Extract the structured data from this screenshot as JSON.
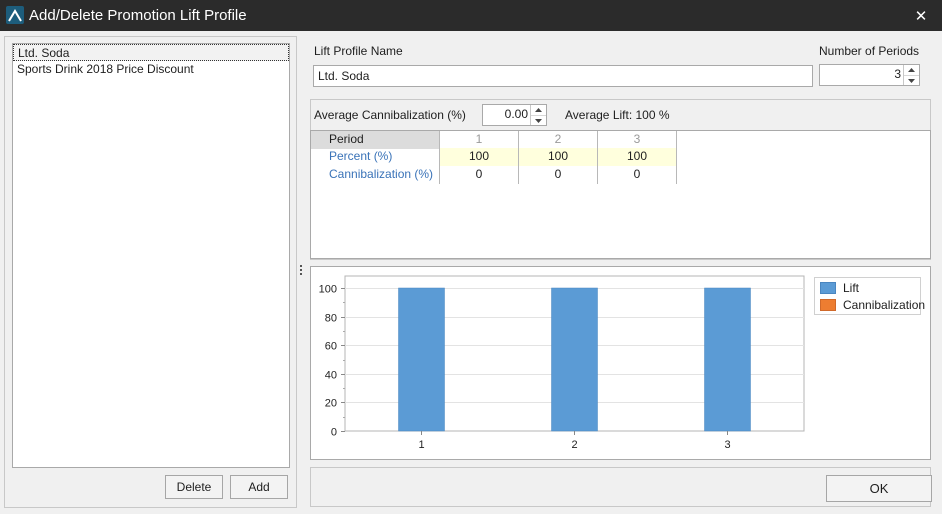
{
  "window": {
    "title": "Add/Delete Promotion Lift Profile",
    "close_glyph": "✕"
  },
  "profiles": {
    "items": [
      "Ltd. Soda",
      "Sports Drink 2018 Price Discount"
    ],
    "selected_index": 0,
    "delete_label": "Delete",
    "add_label": "Add"
  },
  "form": {
    "name_label": "Lift Profile Name",
    "name_value": "Ltd. Soda",
    "periods_label": "Number of Periods",
    "periods_value": "3",
    "cannibalization_label": "Average Cannibalization (%)",
    "cannibalization_value": "0.00",
    "average_lift": "Average Lift: 100 %"
  },
  "grid": {
    "corner_header": "Period",
    "columns": [
      "1",
      "2",
      "3"
    ],
    "rows": [
      {
        "label": "Percent (%)",
        "values": [
          "100",
          "100",
          "100"
        ]
      },
      {
        "label": "Cannibalization (%)",
        "values": [
          "0",
          "0",
          "0"
        ]
      }
    ]
  },
  "chart_data": {
    "type": "bar",
    "categories": [
      "1",
      "2",
      "3"
    ],
    "series": [
      {
        "name": "Lift",
        "values": [
          100,
          100,
          100
        ],
        "color": "#5b9bd5"
      },
      {
        "name": "Cannibalization",
        "values": [
          0,
          0,
          0
        ],
        "color": "#ed7d31"
      }
    ],
    "ylim": [
      0,
      100
    ],
    "yticks": [
      0,
      20,
      40,
      60,
      80,
      100
    ],
    "grid": true,
    "legend_position": "top-right"
  },
  "footer": {
    "ok_label": "OK"
  }
}
